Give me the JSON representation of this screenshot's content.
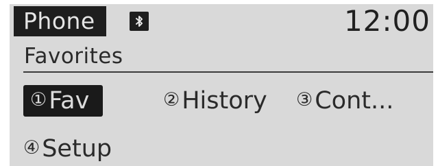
{
  "status_bar": {
    "app_title": "Phone",
    "bluetooth_icon": "bluetooth-icon",
    "time": "12:00"
  },
  "screen": {
    "subtitle": "Favorites"
  },
  "menu": {
    "items": [
      {
        "number": "①",
        "label": "Fav",
        "selected": true
      },
      {
        "number": "②",
        "label": "History",
        "selected": false
      },
      {
        "number": "③",
        "label": "Cont...",
        "selected": false
      },
      {
        "number": "④",
        "label": "Setup",
        "selected": false
      }
    ]
  },
  "colors": {
    "screen_background": "#d9d9d9",
    "highlight": "#1a1a1a",
    "text": "#2a2a2a"
  }
}
